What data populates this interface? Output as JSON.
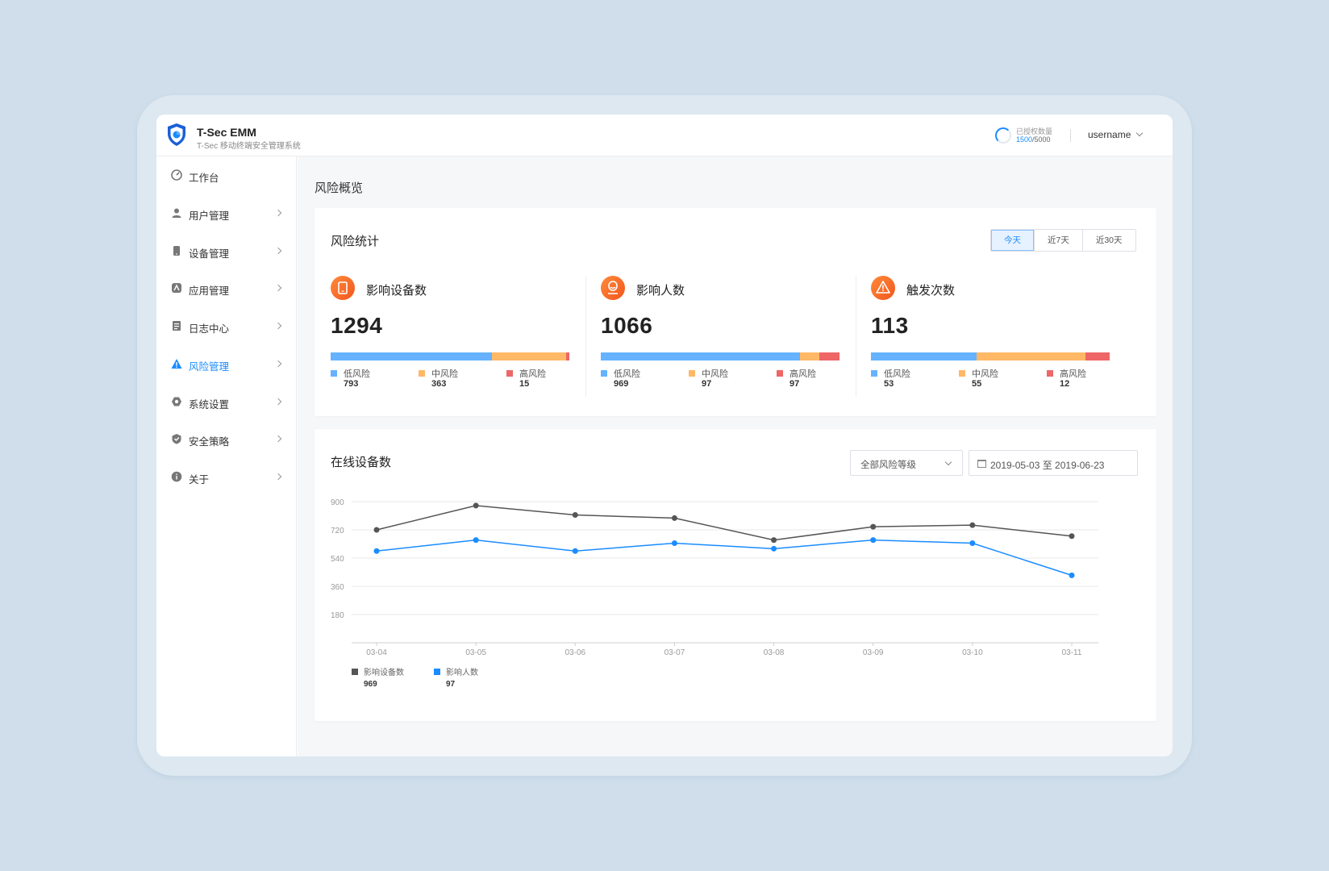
{
  "header": {
    "title": "T-Sec EMM",
    "subtitle": "T-Sec 移动终端安全管理系统",
    "license_label": "已授权数量",
    "license_used": "1500",
    "license_total": "/5000",
    "username": "username"
  },
  "sidebar": {
    "items": [
      {
        "label": "工作台",
        "icon": "dashboard-icon",
        "has_arrow": false,
        "active": false
      },
      {
        "label": "用户管理",
        "icon": "user-icon",
        "has_arrow": true,
        "active": false
      },
      {
        "label": "设备管理",
        "icon": "device-icon",
        "has_arrow": true,
        "active": false
      },
      {
        "label": "应用管理",
        "icon": "app-icon",
        "has_arrow": true,
        "active": false
      },
      {
        "label": "日志中心",
        "icon": "log-icon",
        "has_arrow": true,
        "active": false
      },
      {
        "label": "风险管理",
        "icon": "warning-icon",
        "has_arrow": true,
        "active": true
      },
      {
        "label": "系统设置",
        "icon": "settings-icon",
        "has_arrow": true,
        "active": false
      },
      {
        "label": "安全策略",
        "icon": "shield-check-icon",
        "has_arrow": true,
        "active": false
      },
      {
        "label": "关于",
        "icon": "info-icon",
        "has_arrow": true,
        "active": false
      }
    ]
  },
  "main": {
    "page_title": "风险概览",
    "risk_stats": {
      "title": "风险统计",
      "ranges": [
        "今天",
        "近7天",
        "近30天"
      ],
      "selected_range": "今天",
      "cards": [
        {
          "name": "影响设备数",
          "icon": "tablet-icon",
          "total": "1294",
          "low_label": "低风险",
          "low": "793",
          "mid_label": "中风险",
          "mid": "363",
          "high_label": "高风险",
          "high": "15"
        },
        {
          "name": "影响人数",
          "icon": "person-icon",
          "total": "1066",
          "low_label": "低风险",
          "low": "969",
          "mid_label": "中风险",
          "mid": "97",
          "high_label": "高风险",
          "high": "97"
        },
        {
          "name": "触发次数",
          "icon": "alert-icon",
          "total": "113",
          "low_label": "低风险",
          "low": "53",
          "mid_label": "中风险",
          "mid": "55",
          "high_label": "高风险",
          "high": "12"
        }
      ]
    },
    "online_devices": {
      "title": "在线设备数",
      "risk_level_select": "全部风险等级",
      "date_range": "2019-05-03 至 2019-06-23"
    }
  },
  "colors": {
    "accent": "#1a8cff",
    "low": "#66b2ff",
    "mid": "#ffb866",
    "high": "#ee6666",
    "series_devices": "#555555",
    "series_people": "#1a8cff"
  },
  "chart_data": {
    "type": "line",
    "x": [
      "03-04",
      "03-05",
      "03-06",
      "03-07",
      "03-08",
      "03-09",
      "03-10",
      "03-11"
    ],
    "yticks": [
      180,
      360,
      540,
      720,
      900
    ],
    "ylim": [
      0,
      900
    ],
    "grid": true,
    "legend_position": "bottom-left",
    "series": [
      {
        "name": "影响设备数",
        "legend_value": "969",
        "color": "#555555",
        "values": [
          720,
          875,
          815,
          795,
          655,
          740,
          750,
          680
        ]
      },
      {
        "name": "影响人数",
        "legend_value": "97",
        "color": "#1a8cff",
        "values": [
          585,
          655,
          585,
          635,
          600,
          655,
          635,
          430
        ]
      }
    ]
  }
}
